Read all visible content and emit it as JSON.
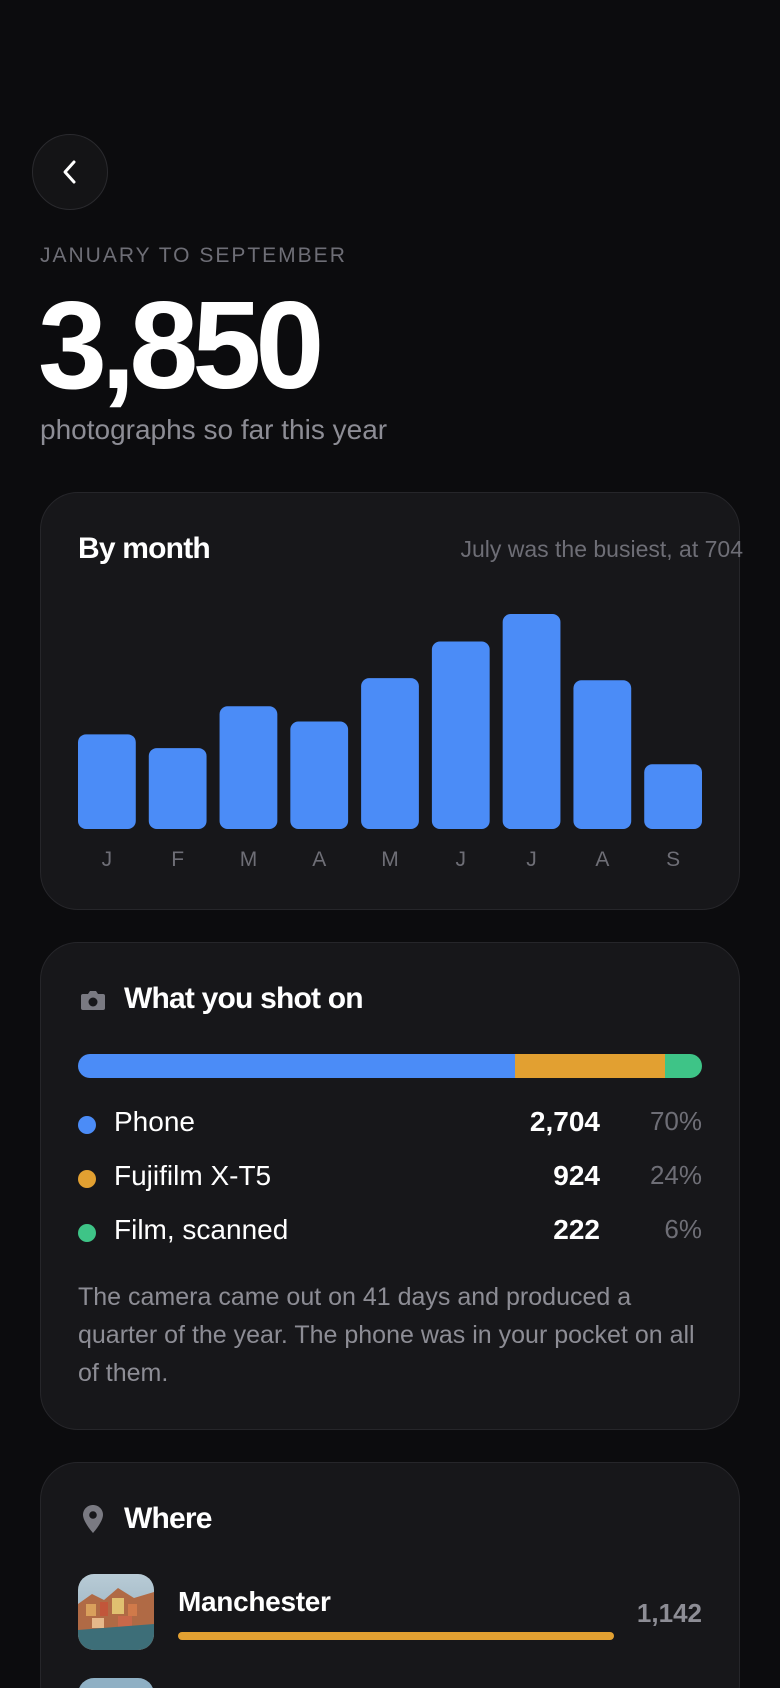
{
  "header": {
    "back_icon": "chevron-left-icon",
    "period": "JANUARY TO SEPTEMBER",
    "total": "3,850",
    "subtitle": "photographs so far this year"
  },
  "by_month": {
    "title": "By month",
    "note": "July was the busiest, at 704"
  },
  "chart_data": {
    "type": "bar",
    "categories": [
      "J",
      "F",
      "M",
      "A",
      "M",
      "J",
      "J",
      "A",
      "S"
    ],
    "values": [
      310,
      265,
      402,
      352,
      494,
      614,
      704,
      487,
      212
    ],
    "ylim": [
      0,
      704
    ],
    "grid": false,
    "color": "#4b8cf7"
  },
  "devices": {
    "icon": "camera-icon",
    "title": "What you shot on",
    "items": [
      {
        "label": "Phone",
        "value": "2,704",
        "pct": "70%",
        "share": 0.7,
        "color": "#4b8cf7"
      },
      {
        "label": "Fujifilm X-T5",
        "value": "924",
        "pct": "24%",
        "share": 0.24,
        "color": "#e2a031"
      },
      {
        "label": "Film, scanned",
        "value": "222",
        "pct": "6%",
        "share": 0.06,
        "color": "#3ec487"
      }
    ],
    "note": "The camera came out on 41 days and produced a quarter of the year. The phone was in your pocket on all of them."
  },
  "where": {
    "icon": "map-pin-icon",
    "title": "Where",
    "places": [
      {
        "name": "Manchester",
        "count": "1,142",
        "share": 1.0,
        "color": "#e2a031"
      },
      {
        "name": "",
        "count": "",
        "share": 0,
        "color": "#e2a031"
      }
    ]
  }
}
